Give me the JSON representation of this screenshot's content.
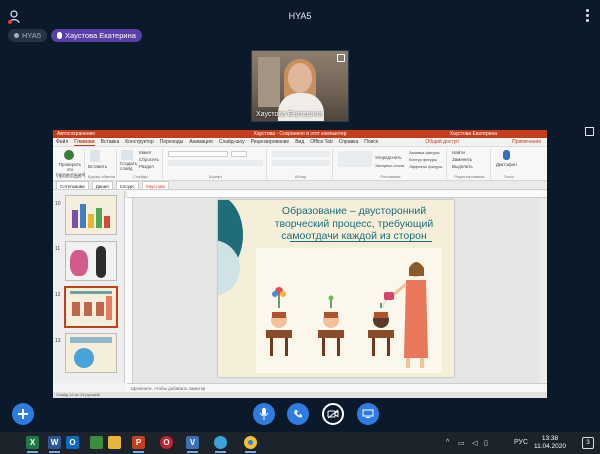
{
  "topbar": {
    "meeting_title": "HYA5"
  },
  "chips": {
    "room_label": "HYA5",
    "speaker_name": "Хаустова Екатерина"
  },
  "webcam": {
    "participant_name": "Хаустова Екатерина"
  },
  "ppt": {
    "title_left": "Автосохранение",
    "title_center": "Хаустова - Сохранено в этот компьютер",
    "title_right": "Хаустова Екатерина",
    "tabs": [
      "Файл",
      "Главная",
      "Вставка",
      "Конструктор",
      "Переходы",
      "Анимация",
      "Слайд-шоу",
      "Рецензирование",
      "Вид",
      "Office Tab",
      "Справка",
      "Поиск"
    ],
    "active_tab_index": 1,
    "share_label": "Общий доступ",
    "notes_tab": "Примечания",
    "ribbon": {
      "presenter_btn": "Проверить это (презентация)",
      "paste_label": "Вставить",
      "new_slide_label": "Создать слайд",
      "layout_label": "Макет",
      "reset_label": "Сбросить",
      "section_label": "Раздел",
      "arrange_label": "Упорядочить",
      "express_styles": "Экспресс-стили",
      "fill_label": "Заливка фигуры",
      "outline_label": "Контур фигуры",
      "effects_label": "Эффекты фигуры",
      "find_label": "Найти",
      "replace_label": "Заменить",
      "select_label": "Выделить",
      "dictate_label": "Диктофон",
      "group_labels": [
        "Презентация",
        "Буфер обмена",
        "Слайды",
        "Шрифт",
        "Абзац",
        "Рисование",
        "Редактирование",
        "Голос"
      ]
    },
    "doc_tabs": [
      "Сотельвова",
      "Дания",
      "Сосурс",
      "Хаустова"
    ],
    "thumb_numbers": [
      "10",
      "11",
      "12",
      "13"
    ],
    "slide_title_lines": [
      "Образование – двусторонний",
      "творческий процесс, требующий",
      "самоотдачи каждой из сторон"
    ],
    "notes_placeholder": "Щелкните, чтобы добавить заметки",
    "status_text": "Слайд 12 из 13   русский"
  },
  "taskbar": {
    "language": "РУС",
    "time": "13:38",
    "date": "11.04.2020",
    "notification_count": "3"
  }
}
